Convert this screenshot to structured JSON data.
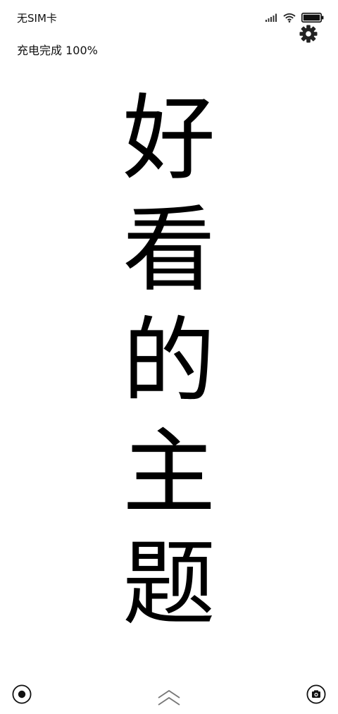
{
  "status_bar": {
    "carrier": "无SIM卡",
    "icons": [
      "signal-icon",
      "wifi-icon",
      "battery-icon"
    ],
    "battery_level": 1.0
  },
  "lock_screen": {
    "charging_status": "充电完成 100%",
    "settings_icon": "gear-icon",
    "headline_chars": [
      "好",
      "看",
      "的",
      "主",
      "题"
    ]
  },
  "bottom_bar": {
    "left_icon": "record-dot-icon",
    "center_icon": "double-chevron-up-icon",
    "right_icon": "camera-icon"
  },
  "colors": {
    "background": "#ffffff",
    "text": "#111111"
  }
}
